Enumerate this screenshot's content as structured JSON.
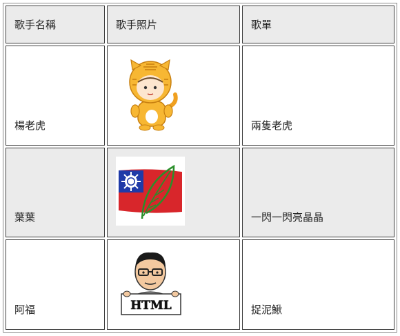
{
  "table": {
    "headers": {
      "name": "歌手名稱",
      "photo": "歌手照片",
      "songs": "歌單"
    },
    "rows": [
      {
        "name": "楊老虎",
        "photo_icon": "tiger-costume-avatar-icon",
        "song": "兩隻老虎"
      },
      {
        "name": "葉葉",
        "photo_icon": "taiwan-flag-leaf-icon",
        "song": "一閃一閃亮晶晶"
      },
      {
        "name": "阿福",
        "photo_icon": "man-holding-html-sign-icon",
        "song": "捉泥鰍",
        "photo_text": "HTML"
      }
    ]
  },
  "colors": {
    "header_bg": "#ebebeb",
    "shaded_row_bg": "#ebebeb",
    "border": "#3c3c3c"
  }
}
